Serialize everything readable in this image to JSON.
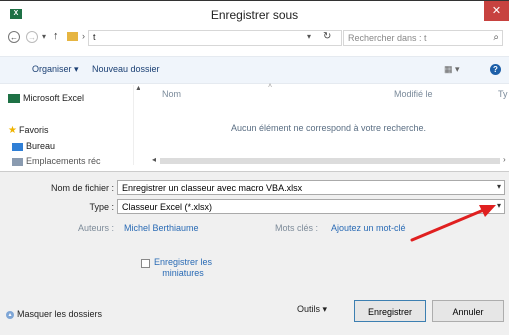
{
  "window": {
    "title": "Enregistrer sous",
    "close_glyph": "✕",
    "app_icon_label": "X"
  },
  "nav": {
    "back_glyph": "←",
    "forward_glyph": "→",
    "history_glyph": "▾",
    "up_glyph": "↑",
    "path_separator": "›",
    "path": "t",
    "dropdown_glyph": "▾",
    "refresh_glyph": "↻",
    "search_placeholder": "Rechercher dans : t",
    "search_glyph": "⌕"
  },
  "toolbar": {
    "organize_label": "Organiser ▾",
    "new_folder_label": "Nouveau dossier",
    "view_glyph": "▦ ▾",
    "help_glyph": "?"
  },
  "sidebar": {
    "items": [
      {
        "label": "Microsoft Excel"
      },
      {
        "label": "Favoris"
      },
      {
        "label": "Bureau"
      },
      {
        "label": "Emplacements réc"
      }
    ]
  },
  "filelist": {
    "columns": [
      "Nom",
      "Modifié le",
      "Ty"
    ],
    "empty_message": "Aucun élément ne correspond à votre recherche."
  },
  "form": {
    "filename_label": "Nom de fichier :",
    "filename_value": "Enregistrer un classeur avec macro VBA.xlsx",
    "type_label": "Type :",
    "type_value": "Classeur Excel (*.xlsx)",
    "authors_label": "Auteurs :",
    "authors_value": "Michel Berthiaume",
    "tags_label": "Mots clés :",
    "tags_value": "Ajoutez un mot-clé",
    "thumbnail_label_1": "Enregistrer les",
    "thumbnail_label_2": "miniatures"
  },
  "footer": {
    "hide_folders": "Masquer les dossiers",
    "hide_folders_glyph": "▴",
    "tools_label": "Outils ▾",
    "save_label": "Enregistrer",
    "cancel_label": "Annuler"
  },
  "colors": {
    "annotation_arrow": "#e02020",
    "link": "#2a6bb5"
  }
}
